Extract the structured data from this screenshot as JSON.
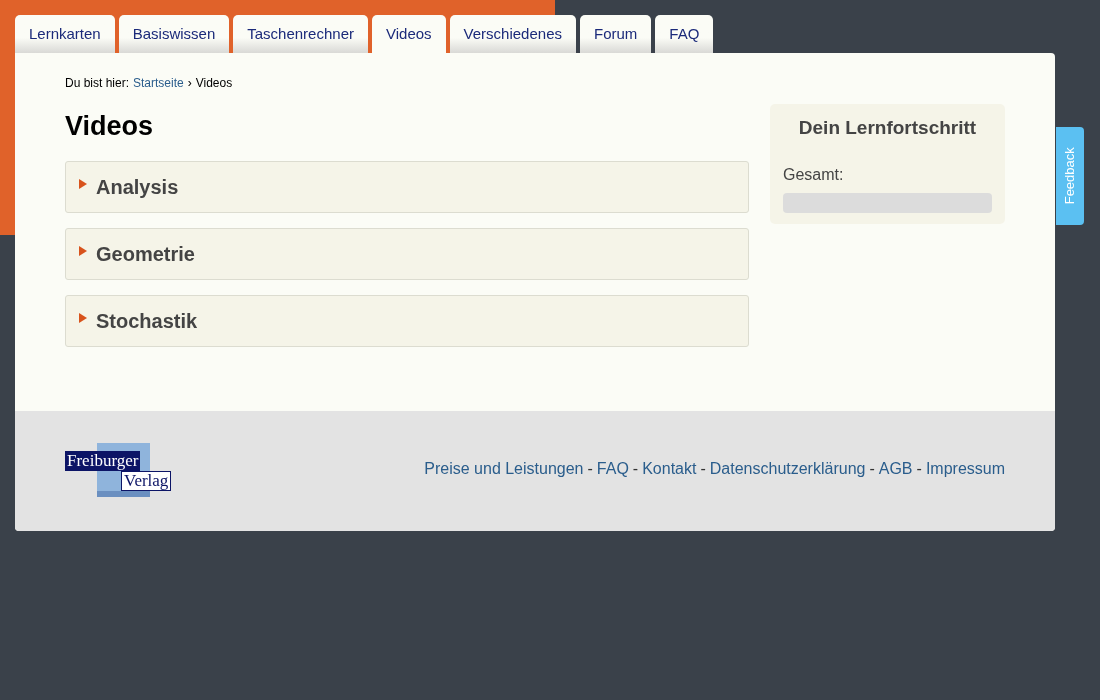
{
  "tabs": [
    {
      "label": "Lernkarten",
      "selected": false
    },
    {
      "label": "Basiswissen",
      "selected": false
    },
    {
      "label": "Taschenrechner",
      "selected": false
    },
    {
      "label": "Videos",
      "selected": true
    },
    {
      "label": "Verschiedenes",
      "selected": false
    },
    {
      "label": "Forum",
      "selected": false
    },
    {
      "label": "FAQ",
      "selected": false
    }
  ],
  "breadcrumb": {
    "prefix": "Du bist hier:",
    "link": "Startseite",
    "separator": "›",
    "current": "Videos"
  },
  "heading": "Videos",
  "sections": [
    {
      "title": "Analysis",
      "expanded": false
    },
    {
      "title": "Geometrie",
      "expanded": false
    },
    {
      "title": "Stochastik",
      "expanded": false
    }
  ],
  "progress": {
    "title": "Dein Lernfortschritt",
    "label": "Gesamt:",
    "level": 0
  },
  "feedback": "Feedback",
  "footer": {
    "logo": [
      "Freiburger",
      "Verlag"
    ],
    "links": [
      "Preise und Leistungen",
      "FAQ",
      "Kontakt",
      "Datenschutzerklärung",
      "AGB",
      "Impressum"
    ],
    "separator": "-"
  }
}
